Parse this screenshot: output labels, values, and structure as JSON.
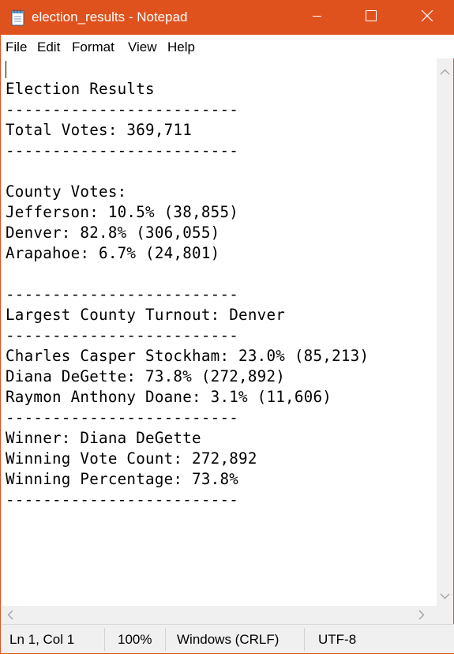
{
  "window": {
    "title": "election_results - Notepad",
    "accent_color": "#e0521d"
  },
  "titlebar_buttons": {
    "minimize_icon": "minimize-icon",
    "maximize_icon": "maximize-icon",
    "close_icon": "close-icon"
  },
  "menu": {
    "items": [
      "File",
      "Edit",
      "Format",
      "View",
      "Help"
    ]
  },
  "document": {
    "lines": [
      "",
      "Election Results",
      "-------------------------",
      "Total Votes: 369,711",
      "-------------------------",
      "",
      "County Votes:",
      "Jefferson: 10.5% (38,855)",
      "Denver: 82.8% (306,055)",
      "Arapahoe: 6.7% (24,801)",
      "",
      "-------------------------",
      "Largest County Turnout: Denver",
      "-------------------------",
      "Charles Casper Stockham: 23.0% (85,213)",
      "Diana DeGette: 73.8% (272,892)",
      "Raymon Anthony Doane: 3.1% (11,606)",
      "-------------------------",
      "Winner: Diana DeGette",
      "Winning Vote Count: 272,892",
      "Winning Percentage: 73.8%",
      "-------------------------"
    ]
  },
  "statusbar": {
    "position": "Ln 1, Col 1",
    "zoom": "100%",
    "line_ending": "Windows (CRLF)",
    "encoding": "UTF-8"
  }
}
